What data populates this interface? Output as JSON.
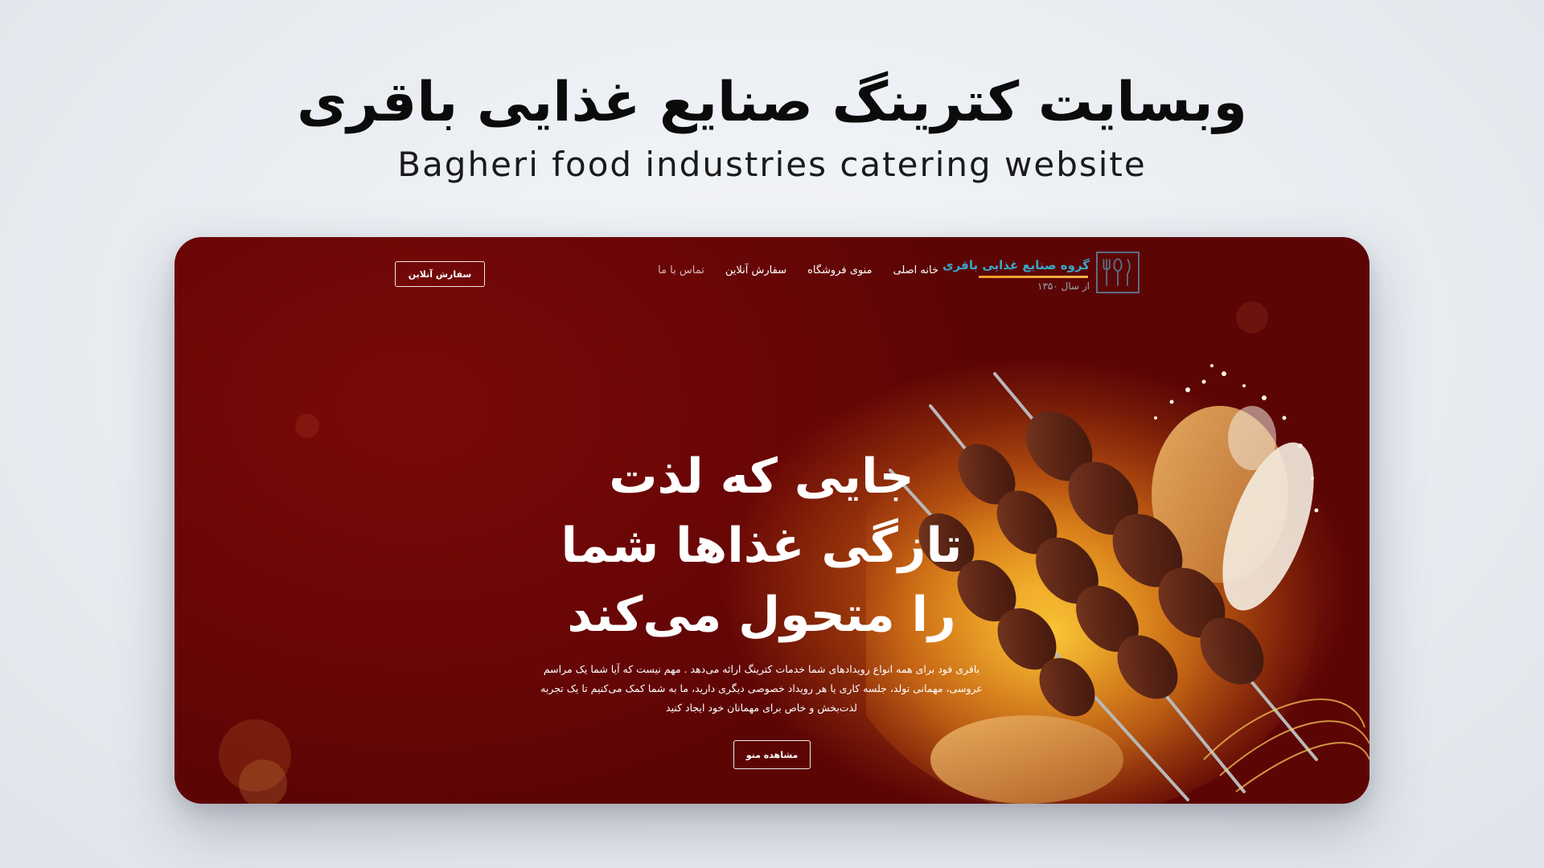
{
  "showcase": {
    "title": "وبسایت کترینگ صنایع غذایی باقری",
    "subtitle": "Bagheri food industries catering website"
  },
  "nav": {
    "logo": {
      "name": "گروه صنایع غذایی باقری",
      "since": "از سال ۱۳۵۰",
      "icon": "fork-spoon-knife-logo-icon"
    },
    "links": [
      {
        "label": "خانه اصلی"
      },
      {
        "label": "منوی فروشگاه"
      },
      {
        "label": "سفارش آنلاین"
      },
      {
        "label": "تماس با ما"
      }
    ],
    "order_button": "سفارش آنلاین"
  },
  "hero": {
    "title_lines": [
      "جایی که لذت",
      "تازگی غذاها شما",
      "را متحول می‌کند"
    ],
    "description": "باقری فود برای همه انواع رویدادهای شما خدمات کترینگ ارائه می‌دهد . مهم نیست که آیا شما یک مراسم عروسی، مهمانی تولد، جلسه کاری یا هر رویداد خصوصی دیگری دارید، ما به شما کمک می‌کنیم تا یک تجربه لذت‌بخش و خاص برای مهمانان خود ایجاد کنید",
    "menu_button": "مشاهده منو",
    "image": "kebab-skewers-with-rice-and-bread"
  },
  "colors": {
    "background": "#e8ecf1",
    "hero_red": "#6a0606",
    "glow": "#ffbe28",
    "logo_blue": "#3aa7c7",
    "logo_orange": "#f29a23"
  }
}
